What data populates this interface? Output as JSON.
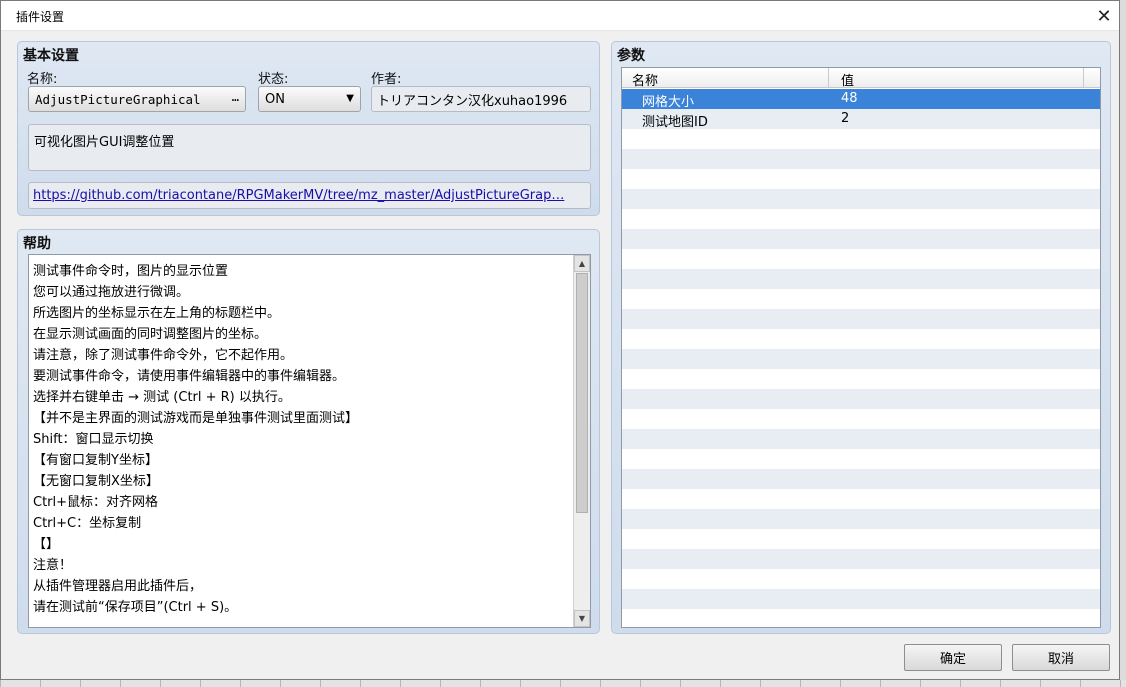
{
  "window": {
    "title": "插件设置"
  },
  "basic": {
    "title": "基本设置",
    "name_label": "名称:",
    "name_value": "AdjustPictureGraphical",
    "name_button": "…",
    "status_label": "状态:",
    "status_value": "ON",
    "status_arrow": "▼",
    "author_label": "作者:",
    "author_value": "トリアコンタン汉化xuhao1996",
    "description": "可视化图片GUI调整位置",
    "url": "https://github.com/triacontane/RPGMakerMV/tree/mz_master/AdjustPictureGrap…"
  },
  "help": {
    "title": "帮助",
    "lines": [
      "测试事件命令时，图片的显示位置",
      "您可以通过拖放进行微调。",
      "所选图片的坐标显示在左上角的标题栏中。",
      "在显示测试画面的同时调整图片的坐标。",
      "请注意，除了测试事件命令外，它不起作用。",
      "要测试事件命令，请使用事件编辑器中的事件编辑器。",
      "选择并右键单击 → 测试 (Ctrl + R) 以执行。",
      "【并不是主界面的测试游戏而是单独事件测试里面测试】",
      "Shift：窗口显示切换",
      "【有窗口复制Y坐标】",
      "【无窗口复制X坐标】",
      "Ctrl+鼠标：对齐网格",
      "Ctrl+C：坐标复制",
      "【】",
      "注意！",
      "从插件管理器启用此插件后，",
      "请在测试前“保存项目”(Ctrl + S)。"
    ]
  },
  "params": {
    "title": "参数",
    "columns": [
      "名称",
      "值"
    ],
    "rows": [
      {
        "name": "网格大小",
        "value": "48",
        "selected": true
      },
      {
        "name": "测试地图ID",
        "value": "2",
        "selected": false
      }
    ]
  },
  "buttons": {
    "ok": "确定",
    "cancel": "取消"
  }
}
